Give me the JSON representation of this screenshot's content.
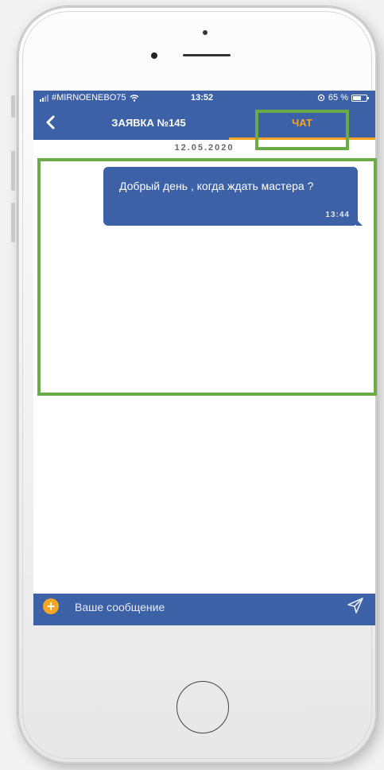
{
  "status_bar": {
    "carrier": "#MIRNOENEBO75",
    "time": "13:52",
    "battery": "65 %",
    "battery_level": 0.65
  },
  "nav": {
    "back_icon": "chevron-left-icon",
    "tab_request": "ЗАЯВКА №145",
    "tab_chat": "ЧАТ"
  },
  "chat": {
    "date": "12.05.2020",
    "messages": [
      {
        "text": "Добрый день , когда ждать мастера ?",
        "time": "13:44"
      }
    ]
  },
  "composer": {
    "placeholder": "Ваше сообщение",
    "add_icon": "plus-icon",
    "send_icon": "send-icon"
  },
  "colors": {
    "primary": "#3d61a6",
    "accent": "#f5a623",
    "highlight": "#6aab45"
  }
}
